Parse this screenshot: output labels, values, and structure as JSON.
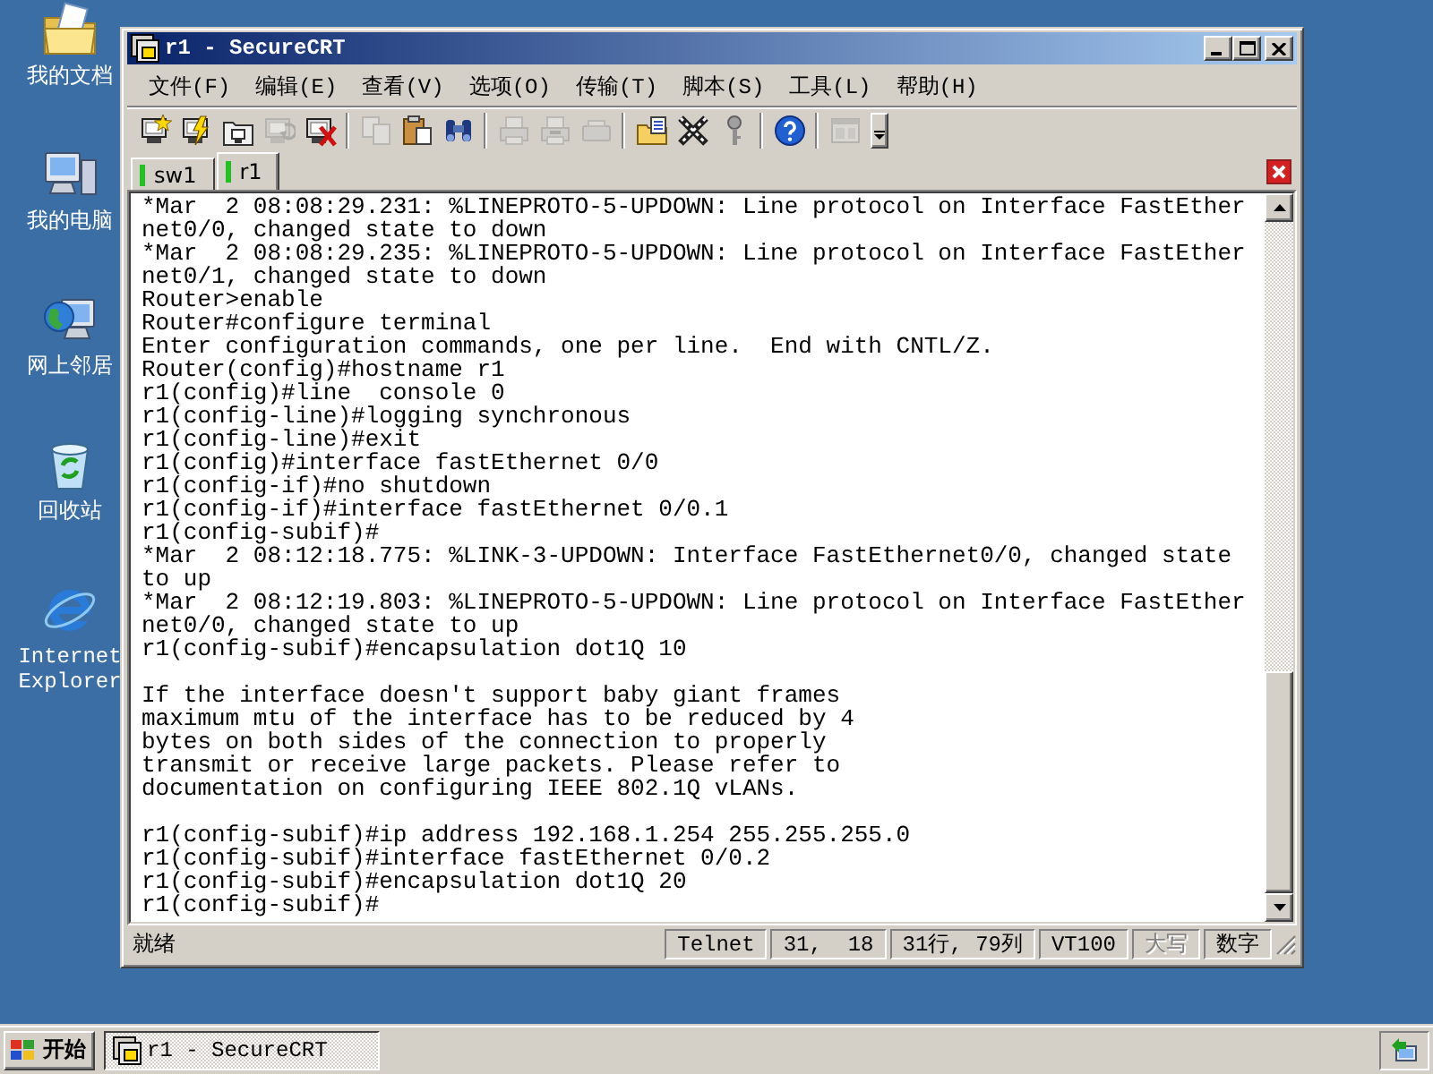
{
  "desktop_icons": [
    {
      "label": "我的文档",
      "kind": "documents"
    },
    {
      "label": "我的电脑",
      "kind": "computer"
    },
    {
      "label": "网上邻居",
      "kind": "network"
    },
    {
      "label": "回收站",
      "kind": "recycle"
    },
    {
      "label": "Internet Explorer",
      "kind": "browser"
    }
  ],
  "window": {
    "title": "r1 - SecureCRT"
  },
  "menu": [
    "文件(F)",
    "编辑(E)",
    "查看(V)",
    "选项(O)",
    "传输(T)",
    "脚本(S)",
    "工具(L)",
    "帮助(H)"
  ],
  "toolbar": {
    "groups": [
      {
        "items": [
          {
            "kind": "quickconnect",
            "disabled": false
          },
          {
            "kind": "connect",
            "disabled": false
          },
          {
            "kind": "tabconnect",
            "disabled": false
          },
          {
            "kind": "reconnect",
            "disabled": true
          },
          {
            "kind": "disconnect",
            "disabled": false
          }
        ]
      },
      {
        "items": [
          {
            "kind": "copy",
            "disabled": true
          },
          {
            "kind": "paste",
            "disabled": false
          },
          {
            "kind": "find",
            "disabled": false
          }
        ]
      },
      {
        "items": [
          {
            "kind": "print",
            "disabled": true
          },
          {
            "kind": "printselection",
            "disabled": true
          },
          {
            "kind": "printsetup",
            "disabled": true
          }
        ]
      },
      {
        "items": [
          {
            "kind": "sessionoptions",
            "disabled": false
          },
          {
            "kind": "globaloptions",
            "disabled": false
          },
          {
            "kind": "keymap",
            "disabled": false
          }
        ]
      },
      {
        "items": [
          {
            "kind": "help",
            "disabled": false
          }
        ]
      },
      {
        "items": [
          {
            "kind": "layout",
            "disabled": true
          }
        ]
      }
    ]
  },
  "tabs": [
    {
      "label": "sw1",
      "selected": false,
      "connected": true
    },
    {
      "label": "r1",
      "selected": true,
      "connected": true
    }
  ],
  "terminal": {
    "blocks": [
      {
        "lines": [
          "*Mar  2 08:08:29.231: %LINEPROTO-5-UPDOWN: Line protocol on Interface FastEther",
          "net0/0, changed state to down",
          "*Mar  2 08:08:29.235: %LINEPROTO-5-UPDOWN: Line protocol on Interface FastEther",
          "net0/1, changed state to down",
          "Router>enable",
          "Router#configure terminal",
          "Enter configuration commands, one per line.  End with CNTL/Z.",
          "Router(config)#hostname r1",
          "r1(config)#line  console 0",
          "r1(config-line)#logging synchronous",
          "r1(config-line)#exit",
          "r1(config)#interface fastEthernet 0/0",
          "r1(config-if)#no shutdown",
          "r1(config-if)#interface fastEthernet 0/0.1",
          "r1(config-subif)#",
          "*Mar  2 08:12:18.775: %LINK-3-UPDOWN: Interface FastEthernet0/0, changed state",
          "to up",
          "*Mar  2 08:12:19.803: %LINEPROTO-5-UPDOWN: Line protocol on Interface FastEther",
          "net0/0, changed state to up",
          "r1(config-subif)#encapsulation dot1Q 10"
        ]
      },
      {
        "lines": [
          "If the interface doesn't support baby giant frames",
          "maximum mtu of the interface has to be reduced by 4",
          "bytes on both sides of the connection to properly",
          "transmit or receive large packets. Please refer to",
          "documentation on configuring IEEE 802.1Q vLANs."
        ]
      },
      {
        "lines": [
          "r1(config-subif)#ip address 192.168.1.254 255.255.255.0",
          "r1(config-subif)#interface fastEthernet 0/0.2",
          "r1(config-subif)#encapsulation dot1Q 20",
          "r1(config-subif)#"
        ]
      }
    ]
  },
  "status_bar": {
    "message": "就绪",
    "panes": [
      {
        "text": "Telnet",
        "disabled": false
      },
      {
        "text": "31,  18",
        "disabled": false
      },
      {
        "text": "31行, 79列",
        "disabled": false
      },
      {
        "text": "VT100",
        "disabled": false
      },
      {
        "text": "大写",
        "disabled": true
      },
      {
        "text": "数字",
        "disabled": false
      }
    ]
  },
  "taskbar": {
    "start": "开始",
    "tasks": [
      {
        "label": "r1 - SecureCRT",
        "selected": true
      }
    ]
  }
}
